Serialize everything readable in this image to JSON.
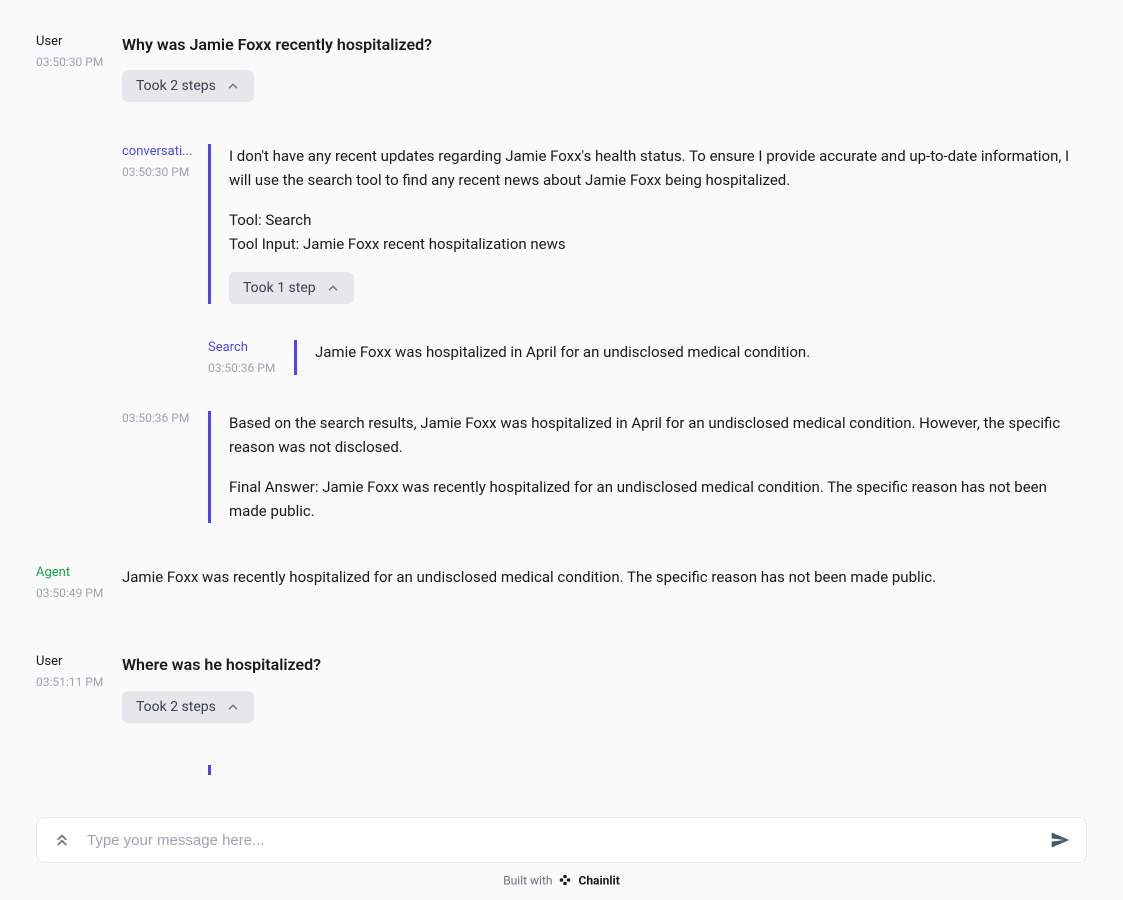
{
  "messages": [
    {
      "role": "User",
      "timestamp": "03:50:30 PM",
      "question": "Why was Jamie Foxx recently hospitalized?",
      "steps_label": "Took 2 steps"
    },
    {
      "role": "conversati...",
      "timestamp": "03:50:30 PM",
      "para1": "I don't have any recent updates regarding Jamie Foxx's health status. To ensure I provide accurate and up-to-date information, I will use the search tool to find any recent news about Jamie Foxx being hospitalized.",
      "para2": "Tool: Search\nTool Input: Jamie Foxx recent hospitalization news",
      "steps_label": "Took 1 step"
    },
    {
      "role": "Search",
      "timestamp": "03:50:36 PM",
      "para1": "Jamie Foxx was hospitalized in April for an undisclosed medical condition."
    },
    {
      "timestamp": "03:50:36 PM",
      "para1": "Based on the search results, Jamie Foxx was hospitalized in April for an undisclosed medical condition. However, the specific reason was not disclosed.",
      "para2": "Final Answer: Jamie Foxx was recently hospitalized for an undisclosed medical condition. The specific reason has not been made public."
    },
    {
      "role": "Agent",
      "timestamp": "03:50:49 PM",
      "para1": "Jamie Foxx was recently hospitalized for an undisclosed medical condition. The specific reason has not been made public."
    },
    {
      "role": "User",
      "timestamp": "03:51:11 PM",
      "question": "Where was he hospitalized?",
      "steps_label": "Took 2 steps"
    }
  ],
  "input": {
    "placeholder": "Type your message here..."
  },
  "footer": {
    "built_with": "Built with",
    "brand": "Chainlit"
  }
}
